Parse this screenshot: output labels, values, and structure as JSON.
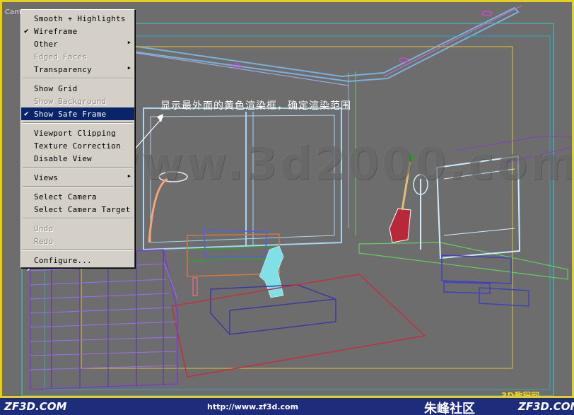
{
  "viewport": {
    "label": "Came",
    "watermark": "www.3d2000.com",
    "annotation": "显示最外面的黄色渲染框，确定渲染范围",
    "corner_logo": "3D教程网"
  },
  "menu": {
    "items": [
      {
        "label": "Smooth + Highlights",
        "checked": "",
        "submenu": "",
        "state": "normal"
      },
      {
        "label": "Wireframe",
        "checked": "✔",
        "submenu": "",
        "state": "normal"
      },
      {
        "label": "Other",
        "checked": "",
        "submenu": "▶",
        "state": "normal"
      },
      {
        "label": "Edged Faces",
        "checked": "",
        "submenu": "",
        "state": "disabled"
      },
      {
        "label": "Transparency",
        "checked": "",
        "submenu": "▶",
        "state": "normal"
      },
      {
        "label": "Show Grid",
        "checked": "",
        "submenu": "",
        "state": "normal"
      },
      {
        "label": "Show Background",
        "checked": "",
        "submenu": "",
        "state": "disabled"
      },
      {
        "label": "Show Safe Frame",
        "checked": "✔",
        "submenu": "",
        "state": "selected"
      },
      {
        "label": "Viewport Clipping",
        "checked": "",
        "submenu": "",
        "state": "normal"
      },
      {
        "label": "Texture Correction",
        "checked": "",
        "submenu": "",
        "state": "normal"
      },
      {
        "label": "Disable View",
        "checked": "",
        "submenu": "",
        "state": "normal"
      },
      {
        "label": "Views",
        "checked": "",
        "submenu": "▶",
        "state": "normal"
      },
      {
        "label": "Select Camera",
        "checked": "",
        "submenu": "",
        "state": "normal"
      },
      {
        "label": "Select Camera Target",
        "checked": "",
        "submenu": "",
        "state": "normal"
      },
      {
        "label": "Undo",
        "checked": "",
        "submenu": "",
        "state": "disabled"
      },
      {
        "label": "Redo",
        "checked": "",
        "submenu": "",
        "state": "disabled"
      },
      {
        "label": "Configure...",
        "checked": "",
        "submenu": "",
        "state": "normal"
      }
    ]
  },
  "footer": {
    "left": "ZF3D.COM",
    "url": "http://www.zf3d.com",
    "logo": "朱峰社区",
    "right": "ZF3D.COM"
  },
  "colors": {
    "safe_frame": "#e6cf1a",
    "menu_bg": "#d4d0c8",
    "menu_highlight": "#0a246a",
    "footer_bg": "#1e2c7c",
    "viewport_bg": "#6d6d6d"
  }
}
